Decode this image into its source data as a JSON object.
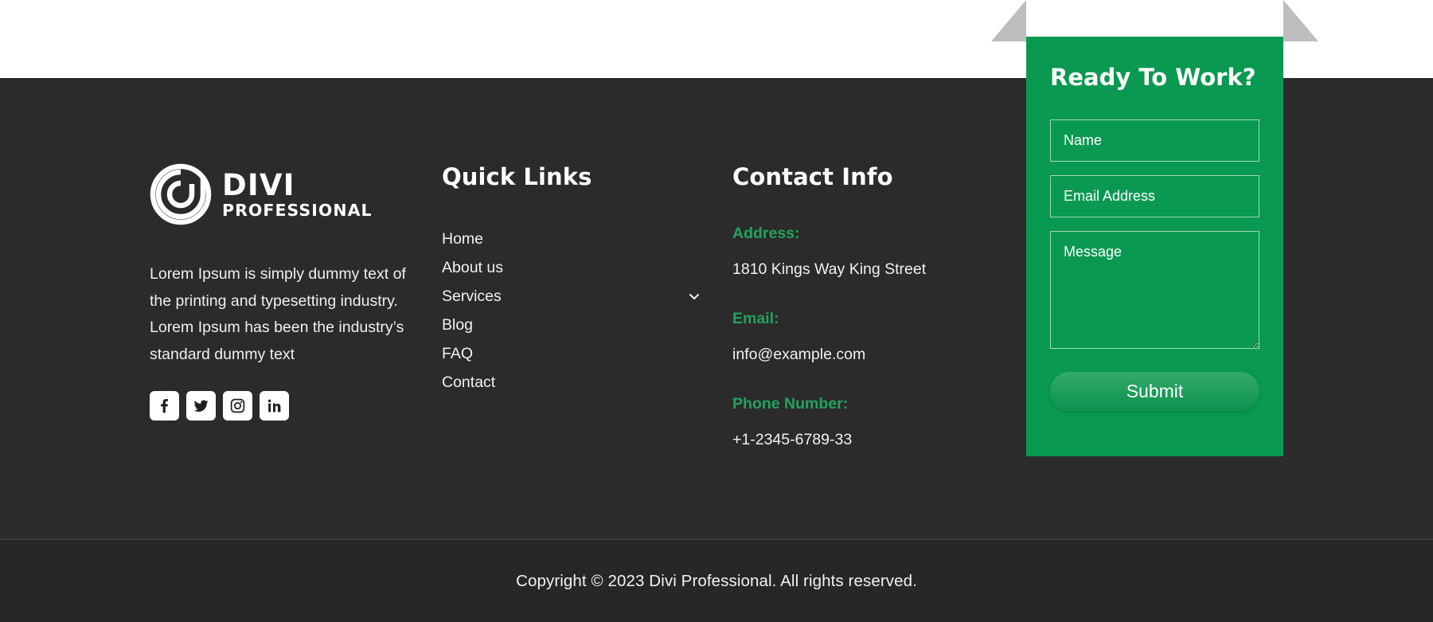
{
  "theme": {
    "footer_bg": "#2b2b2b",
    "copyright_bg": "#272727",
    "accent_green": "#099950",
    "label_green": "#21a35c",
    "text_light": "#f2f2f2",
    "ribbon_gray": "#bdbdbd"
  },
  "brand": {
    "logo_icon": "divi-spiral-logo-icon",
    "name_line1": "DIVI",
    "name_line2": "PROFESSIONAL",
    "description": "Lorem Ipsum is simply dummy text of the printing and typesetting industry. Lorem Ipsum has been the industry’s standard dummy text",
    "social": [
      {
        "name": "facebook",
        "icon": "facebook-icon",
        "glyph": "f"
      },
      {
        "name": "twitter",
        "icon": "twitter-icon",
        "glyph": "t"
      },
      {
        "name": "instagram",
        "icon": "instagram-icon",
        "glyph": "i"
      },
      {
        "name": "linkedin",
        "icon": "linkedin-icon",
        "glyph": "in"
      }
    ]
  },
  "quick_links": {
    "title": "Quick Links",
    "items": [
      {
        "label": "Home",
        "has_submenu": false
      },
      {
        "label": "About us",
        "has_submenu": false
      },
      {
        "label": "Services",
        "has_submenu": true
      },
      {
        "label": "Blog",
        "has_submenu": false
      },
      {
        "label": "FAQ",
        "has_submenu": false
      },
      {
        "label": "Contact",
        "has_submenu": false
      }
    ]
  },
  "contact_info": {
    "title": "Contact Info",
    "address_label": "Address:",
    "address_value": "1810 Kings Way King Street",
    "email_label": "Email:",
    "email_value": "info@example.com",
    "phone_label": "Phone Number:",
    "phone_value": "+1-2345-6789-33"
  },
  "cta": {
    "title": "Ready To Work?",
    "name_placeholder": "Name",
    "name_value": "",
    "email_placeholder": "Email Address",
    "email_value": "",
    "message_placeholder": "Message",
    "message_value": "",
    "submit_label": "Submit"
  },
  "footer": {
    "copyright": "Copyright © 2023 Divi Professional. All rights reserved."
  }
}
